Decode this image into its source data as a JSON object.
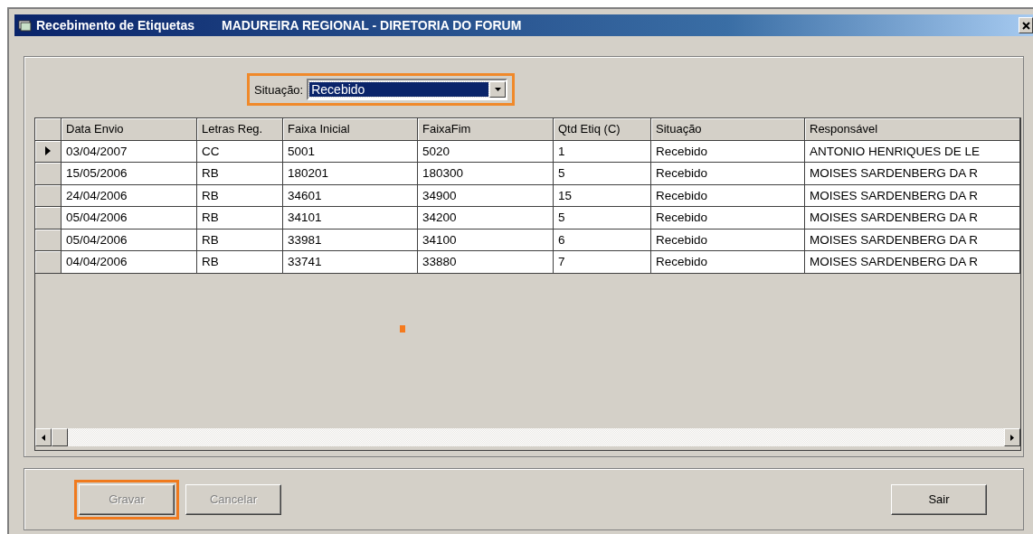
{
  "window": {
    "title": "Recebimento de Etiquetas",
    "subtitle": "MADUREIRA REGIONAL - DIRETORIA DO FORUM"
  },
  "filter": {
    "label": "Situação:",
    "value": "Recebido",
    "highlighted": true
  },
  "table": {
    "columns": [
      "Data Envio",
      "Letras Reg.",
      "Faixa Inicial",
      "FaixaFim",
      "Qtd Etiq (C)",
      "Situação",
      "Responsável"
    ],
    "rows": [
      {
        "current": true,
        "cells": [
          "03/04/2007",
          "CC",
          "5001",
          "5020",
          "1",
          "Recebido",
          "ANTONIO HENRIQUES DE LE"
        ]
      },
      {
        "current": false,
        "cells": [
          "15/05/2006",
          "RB",
          "180201",
          "180300",
          "5",
          "Recebido",
          "MOISES SARDENBERG DA R"
        ]
      },
      {
        "current": false,
        "cells": [
          "24/04/2006",
          "RB",
          "34601",
          "34900",
          "15",
          "Recebido",
          "MOISES SARDENBERG DA R"
        ]
      },
      {
        "current": false,
        "cells": [
          "05/04/2006",
          "RB",
          "34101",
          "34200",
          "5",
          "Recebido",
          "MOISES SARDENBERG DA R"
        ]
      },
      {
        "current": false,
        "cells": [
          "05/04/2006",
          "RB",
          "33981",
          "34100",
          "6",
          "Recebido",
          "MOISES SARDENBERG DA R"
        ]
      },
      {
        "current": false,
        "cells": [
          "04/04/2006",
          "RB",
          "33741",
          "33880",
          "7",
          "Recebido",
          "MOISES SARDENBERG DA R"
        ]
      }
    ]
  },
  "buttons": [
    {
      "label": "Gravar",
      "disabled": true,
      "highlighted": true
    },
    {
      "label": "Cancelar",
      "disabled": true,
      "highlighted": false
    },
    {
      "label": "Sair",
      "disabled": false,
      "highlighted": false
    }
  ]
}
